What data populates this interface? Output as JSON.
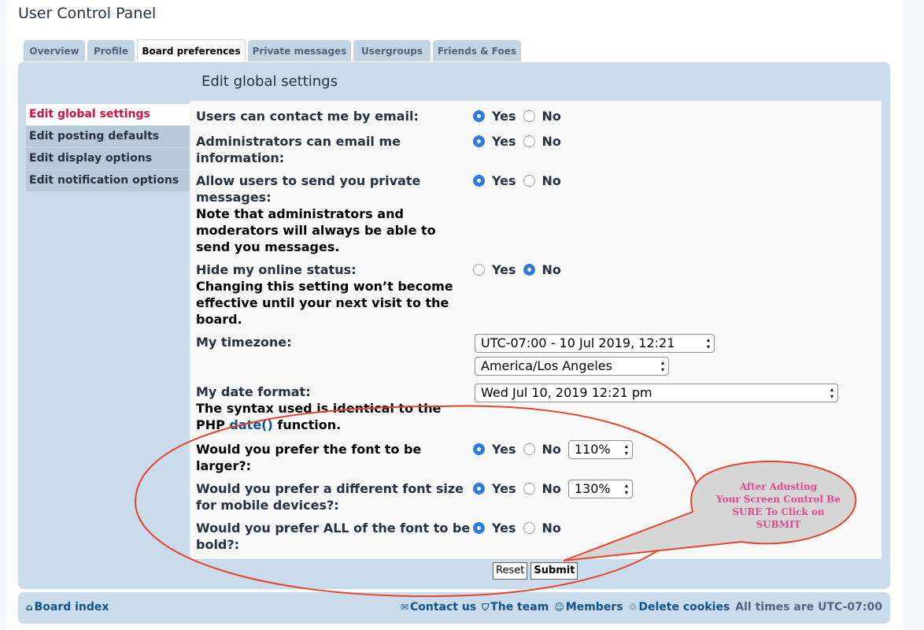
{
  "page": {
    "title": "User Control Panel"
  },
  "tabs": [
    {
      "label": "Overview",
      "active": false
    },
    {
      "label": "Profile",
      "active": false
    },
    {
      "label": "Board preferences",
      "active": true
    },
    {
      "label": "Private messages",
      "active": false
    },
    {
      "label": "Usergroups",
      "active": false
    },
    {
      "label": "Friends & Foes",
      "active": false
    }
  ],
  "sidebar": {
    "items": [
      {
        "label": "Edit global settings",
        "active": true
      },
      {
        "label": "Edit posting defaults",
        "active": false
      },
      {
        "label": "Edit display options",
        "active": false
      },
      {
        "label": "Edit notification options",
        "active": false
      }
    ]
  },
  "content": {
    "title": "Edit global settings",
    "yes_label": "Yes",
    "no_label": "No",
    "email_contact": {
      "label": "Users can contact me by email:",
      "selected": "Yes"
    },
    "admin_email": {
      "label": "Administrators can email me information:",
      "selected": "Yes"
    },
    "allow_pm": {
      "label": "Allow users to send you private messages:",
      "explain": "Note that administrators and moderators will always be able to send you messages.",
      "selected": "Yes"
    },
    "hide_online": {
      "label": "Hide my online status:",
      "explain": "Changing this setting won’t become effective until your next visit to the board.",
      "selected": "No"
    },
    "timezone": {
      "label": "My timezone:",
      "offset_value": "UTC-07:00 - 10 Jul 2019, 12:21",
      "zone_value": "America/Los Angeles"
    },
    "date_format": {
      "label": "My date format:",
      "explain_before": "The syntax used is identical to the PHP ",
      "explain_link": "date()",
      "explain_after": " function.",
      "value": "Wed Jul 10, 2019 12:21 pm"
    },
    "font_larger": {
      "label": "Would you prefer the font to be larger?:",
      "selected": "Yes",
      "size_value": "110%"
    },
    "font_mobile": {
      "label": "Would you prefer a different font size for mobile devices?:",
      "selected": "Yes",
      "size_value": "130%"
    },
    "font_bold": {
      "label": "Would you prefer ALL of the font to be bold?:",
      "selected": "Yes"
    },
    "reset_label": "Reset",
    "submit_label": "Submit"
  },
  "annotation": {
    "line1": "After Adusting",
    "line2": "Your Screen Control Be",
    "line3": "SURE To Click on",
    "line4": "SUBMIT",
    "color": "#e8442c"
  },
  "footer": {
    "board_index": "Board index",
    "contact": "Contact us",
    "team": "The team",
    "members": "Members",
    "delete_cookies": "Delete cookies",
    "times": "All times are UTC-07:00"
  },
  "colors": {
    "panel_bg": "#cadceb",
    "accent_red": "#d31141",
    "link": "#105289",
    "radio_on": "#2d7ce0"
  }
}
